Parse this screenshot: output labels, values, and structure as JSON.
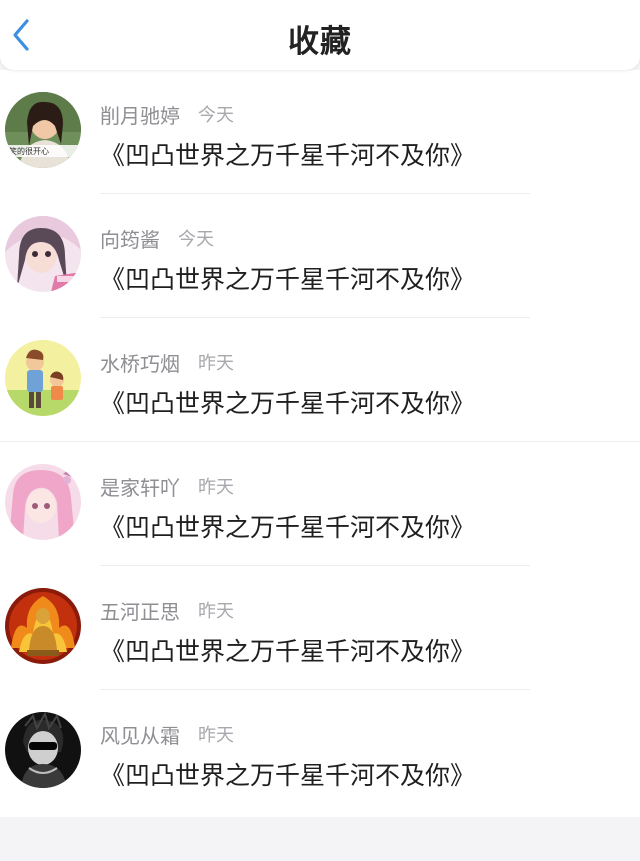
{
  "header": {
    "title": "收藏",
    "back_icon": "chevron-left-icon",
    "accent": "#3d8fe0"
  },
  "favorites": [
    {
      "name": "削月驰婷",
      "time": "今天",
      "work": "《凹凸世界之万千星千河不及你》",
      "avatar_caption": "笑的很开心"
    },
    {
      "name": "向筠酱",
      "time": "今天",
      "work": "《凹凸世界之万千星千河不及你》"
    },
    {
      "name": "水桥巧烟",
      "time": "昨天",
      "work": "《凹凸世界之万千星千河不及你》"
    },
    {
      "name": "是家轩吖",
      "time": "昨天",
      "work": "《凹凸世界之万千星千河不及你》"
    },
    {
      "name": "五河正思",
      "time": "昨天",
      "work": "《凹凸世界之万千星千河不及你》"
    },
    {
      "name": "风见从霜",
      "time": "昨天",
      "work": "《凹凸世界之万千星千河不及你》"
    }
  ]
}
